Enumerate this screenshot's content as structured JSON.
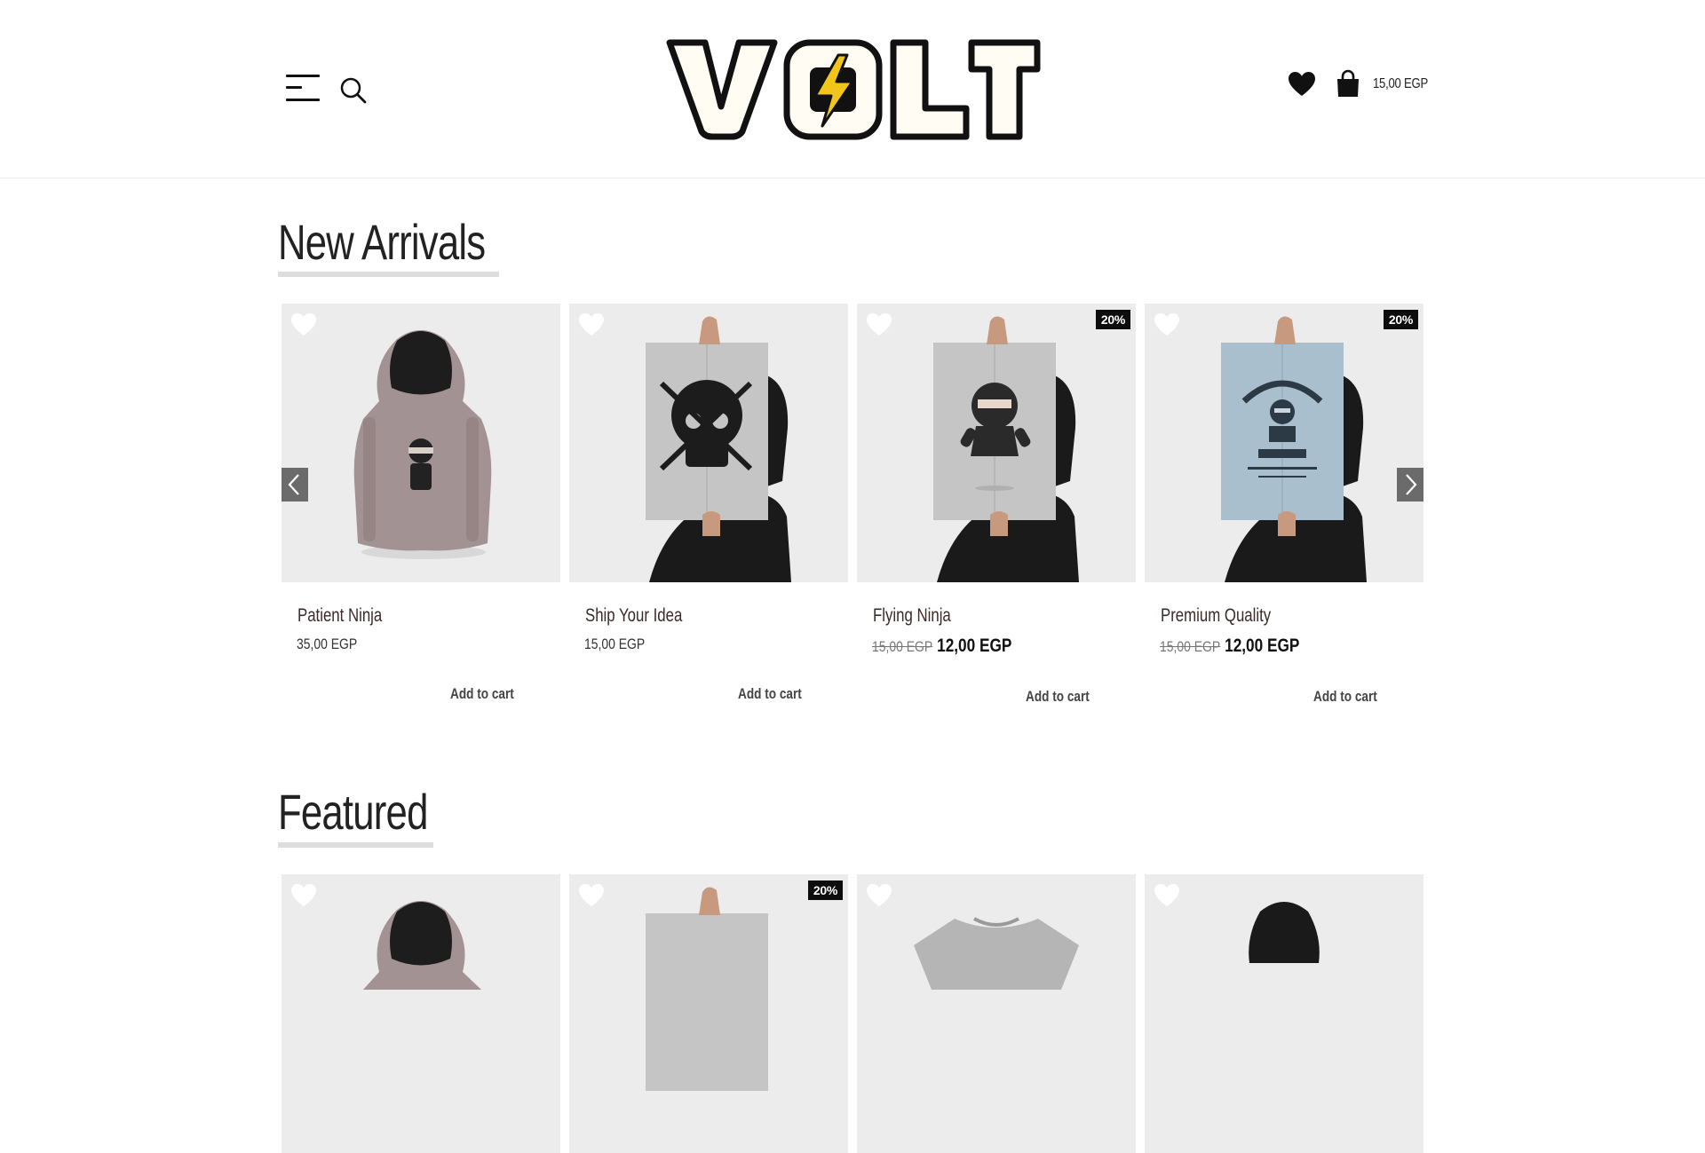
{
  "header": {
    "brand": "VOLT",
    "cart_total": "15,00 EGP",
    "menu_icon": "hamburger-menu-icon",
    "search_icon": "search-icon",
    "wishlist_icon": "heart-icon",
    "cart_icon": "shopping-bag-icon"
  },
  "new_arrivals": {
    "title": "New Arrivals",
    "products": [
      {
        "name": "Patient Ninja",
        "price": "35,00 EGP",
        "button": "Add to cart",
        "image": "hoodie-ninja"
      },
      {
        "name": "Ship Your Idea",
        "price": "15,00 EGP",
        "button": "Add to cart",
        "image": "poster-skull"
      },
      {
        "name": "Flying Ninja",
        "badge": "20%",
        "old_price": "15,00 EGP",
        "new_price": "12,00 EGP",
        "button": "Add to cart",
        "image": "poster-ninja"
      },
      {
        "name": "Premium Quality",
        "badge": "20%",
        "old_price": "15,00 EGP",
        "new_price": "12,00 EGP",
        "button": "Add to cart",
        "image": "poster-woothemes"
      }
    ]
  },
  "featured": {
    "title": "Featured",
    "products": [
      {
        "image": "hoodie"
      },
      {
        "badge": "20%",
        "image": "poster"
      },
      {
        "image": "tshirt"
      },
      {
        "image": "hoodie-black"
      }
    ]
  },
  "colors": {
    "accent": "#f2c51b",
    "badge": "#0d0d0d",
    "card_bg": "#ececec"
  }
}
